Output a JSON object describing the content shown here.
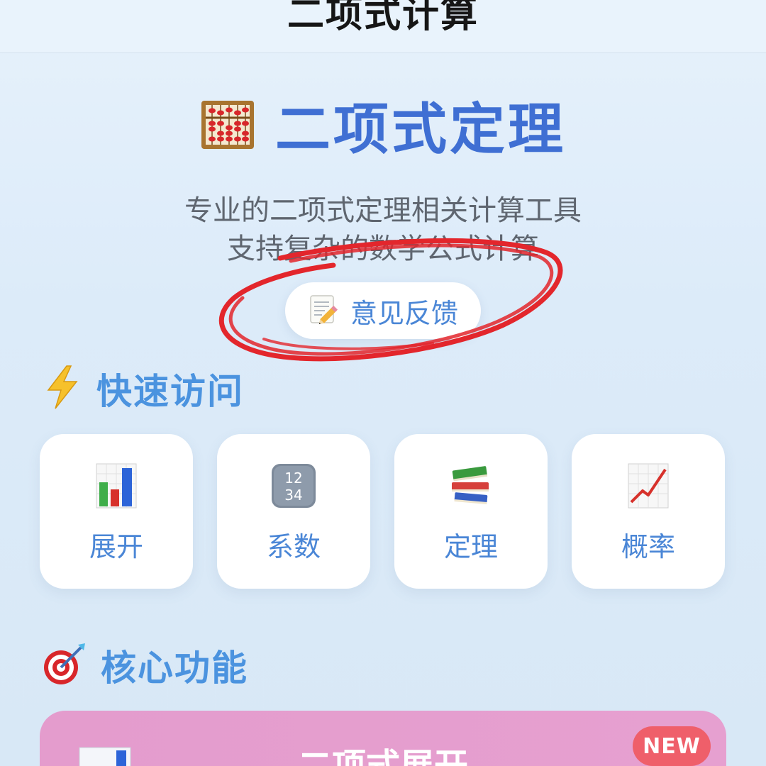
{
  "nav": {
    "title": "二项式计算"
  },
  "hero": {
    "icon": "abacus-icon",
    "title": "二项式定理",
    "description_line1": "专业的二项式定理相关计算工具",
    "description_line2": "支持复杂的数学公式计算"
  },
  "feedback": {
    "icon": "memo-pencil-icon",
    "label": "意见反馈"
  },
  "quick_access": {
    "icon": "lightning-icon",
    "title": "快速访问",
    "items": [
      {
        "icon": "bar-chart-icon",
        "label": "展开"
      },
      {
        "icon": "number-keycap-1234-icon",
        "label": "系数"
      },
      {
        "icon": "books-icon",
        "label": "定理"
      },
      {
        "icon": "line-chart-up-icon",
        "label": "概率"
      }
    ]
  },
  "core_features": {
    "icon": "dart-target-icon",
    "title": "核心功能",
    "cards": [
      {
        "title": "二项式展开",
        "badge": "NEW",
        "icon": "bar-chart-icon"
      }
    ]
  },
  "colors": {
    "accent_blue": "#3f6fd3",
    "link_blue": "#4a86d6",
    "section_blue": "#4b93df",
    "annotation_red": "#e3262c",
    "card_pink": "#e49ccd",
    "badge_red": "#ef5f6a"
  }
}
